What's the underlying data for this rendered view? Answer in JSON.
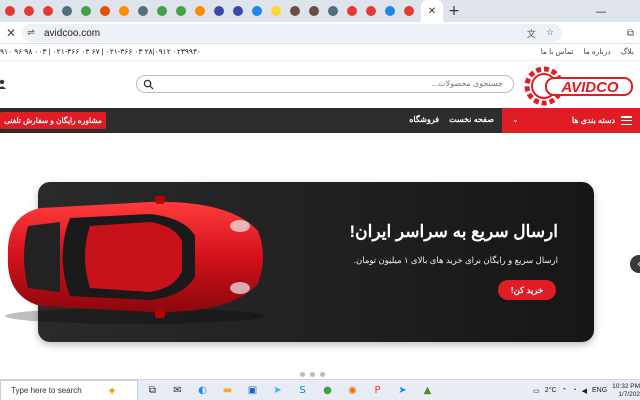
{
  "browser": {
    "new_tab": "+",
    "url": "avidcoo.com",
    "close_glyph": "✕",
    "win_minimize": "—",
    "tab_favicon_colors": [
      "#e53935",
      "#e53935",
      "#e53935",
      "#546e7a",
      "#43a047",
      "#e65100",
      "#fb8c00",
      "#546e7a",
      "#43a047",
      "#43a047",
      "#fb8c00",
      "#3949ab",
      "#3949ab",
      "#1e88e5",
      "#fdd835",
      "#6d4c41",
      "#6d4c41",
      "#546e7a",
      "#e53935",
      "#e53935",
      "#1e88e5",
      "#e53935"
    ]
  },
  "site": {
    "phones": "۹۱۰ ۹۶ ۹۸ ۰۰۳ | ۰۲۱-۳۶۶ ۰۳ ۶۷ | ۰۲۱-۳۶۶ ۰۳ ۲۸|۰۹۱۲ ۰۲۳۹۹۳۰",
    "top_links": [
      "بلاگ",
      "درباره ما",
      "تماس با ما"
    ],
    "search_placeholder": "جستجوی محصولات...",
    "logo_text": "AVIDCO",
    "categories_label": "دسته بندی ها",
    "nav_links": [
      "صفحه نخست",
      "فروشگاه"
    ],
    "consult_label": "مشاوره رایگان و سفارش تلفنی"
  },
  "hero": {
    "title": "ارسال سریع به سراسر ایران!",
    "subtitle": "ارسال سریع و رایگان برای خرید های بالای ۱ میلیون تومان.",
    "cta": "خرید کن!"
  },
  "taskbar": {
    "search_placeholder": "Type here to search",
    "temperature": "2°C",
    "language": "ENG",
    "time": "10:32 PM",
    "date": "1/7/202"
  },
  "colors": {
    "brand_red": "#e01c24",
    "nav_dark": "#2d2d2d"
  }
}
